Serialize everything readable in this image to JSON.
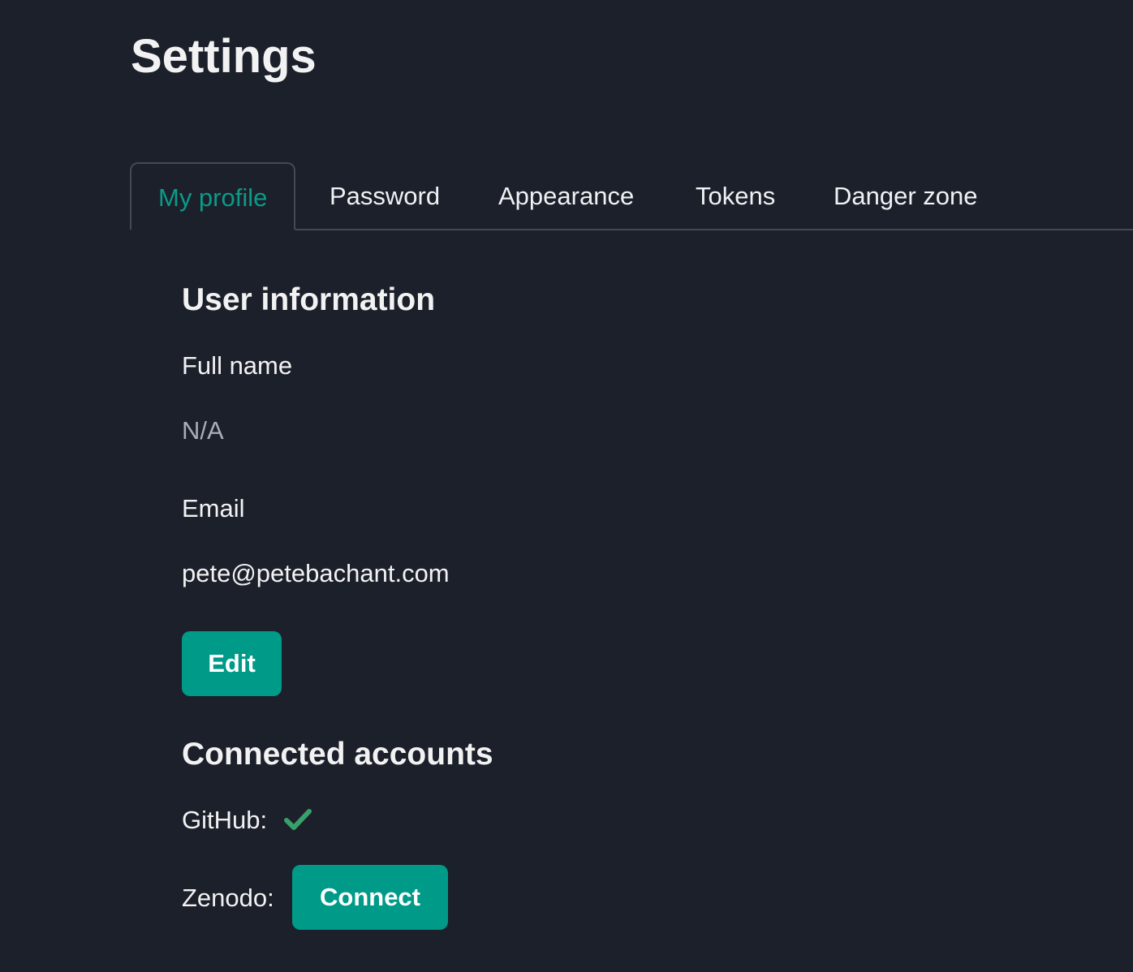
{
  "page_title": "Settings",
  "tabs": [
    {
      "label": "My profile",
      "active": true
    },
    {
      "label": "Password"
    },
    {
      "label": "Appearance"
    },
    {
      "label": "Tokens"
    },
    {
      "label": "Danger zone"
    }
  ],
  "user_info": {
    "heading": "User information",
    "full_name_label": "Full name",
    "full_name_value": "N/A",
    "email_label": "Email",
    "email_value": "pete@petebachant.com",
    "edit_label": "Edit"
  },
  "connected": {
    "heading": "Connected accounts",
    "github_label": "GitHub:",
    "github_status": "check-icon",
    "zenodo_label": "Zenodo:",
    "connect_label": "Connect"
  },
  "colors": {
    "accent": "#009a88",
    "check": "#38a169",
    "background": "#1b202b"
  }
}
